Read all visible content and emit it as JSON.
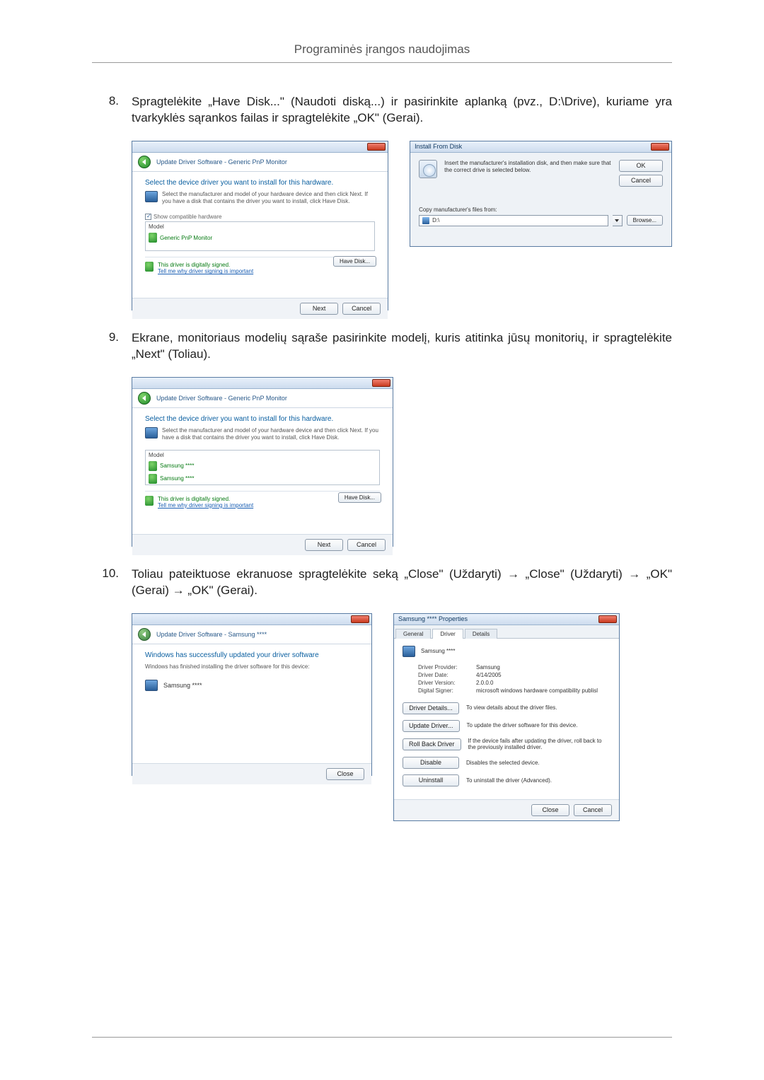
{
  "page": {
    "header": "Programinės įrangos naudojimas"
  },
  "steps": {
    "s8": {
      "num": "8.",
      "text": "Spragtelėkite „Have Disk...\" (Naudoti diską...) ir pasirinkite aplanką (pvz., D:\\Drive), kuriame yra tvarkyklės sąrankos failas ir spragtelėkite „OK\" (Gerai)."
    },
    "s9": {
      "num": "9.",
      "text": "Ekrane, monitoriaus modelių sąraše pasirinkite modelį, kuris atitinka jūsų monitorių, ir spragtelėkite „Next\" (Toliau)."
    },
    "s10": {
      "num": "10.",
      "text": "Toliau pateiktuose ekranuose spragtelėkite seką „Close\" (Uždaryti) → „Close\" (Uždaryti) → „OK\" (Gerai) → „OK\" (Gerai)."
    }
  },
  "wiz1": {
    "breadcrumb": "Update Driver Software - Generic PnP Monitor",
    "heading": "Select the device driver you want to install for this hardware.",
    "sub": "Select the manufacturer and model of your hardware device and then click Next. If you have a disk that contains the driver you want to install, click Have Disk.",
    "chk": "Show compatible hardware",
    "col": "Model",
    "item1": "Generic PnP Monitor",
    "signed": "This driver is digitally signed.",
    "signed_link": "Tell me why driver signing is important",
    "havedisk": "Have Disk...",
    "next": "Next",
    "cancel": "Cancel"
  },
  "ifd": {
    "title": "Install From Disk",
    "text": "Insert the manufacturer's installation disk, and then make sure that the correct drive is selected below.",
    "ok": "OK",
    "cancel": "Cancel",
    "copy": "Copy manufacturer's files from:",
    "path": "D:\\",
    "browse": "Browse..."
  },
  "wiz2": {
    "breadcrumb": "Update Driver Software - Generic PnP Monitor",
    "heading": "Select the device driver you want to install for this hardware.",
    "sub": "Select the manufacturer and model of your hardware device and then click Next. If you have a disk that contains the driver you want to install, click Have Disk.",
    "col": "Model",
    "item1": "Samsung ****",
    "item2": "Samsung ****",
    "signed": "This driver is digitally signed.",
    "signed_link": "Tell me why driver signing is important",
    "havedisk": "Have Disk...",
    "next": "Next",
    "cancel": "Cancel"
  },
  "wiz3": {
    "breadcrumb": "Update Driver Software - Samsung ****",
    "heading": "Windows has successfully updated your driver software",
    "sub": "Windows has finished installing the driver software for this device:",
    "model": "Samsung ****",
    "close": "Close"
  },
  "props": {
    "title": "Samsung **** Properties",
    "tab_general": "General",
    "tab_driver": "Driver",
    "tab_details": "Details",
    "device": "Samsung ****",
    "provider_k": "Driver Provider:",
    "provider_v": "Samsung",
    "date_k": "Driver Date:",
    "date_v": "4/14/2005",
    "version_k": "Driver Version:",
    "version_v": "2.0.0.0",
    "signer_k": "Digital Signer:",
    "signer_v": "microsoft windows hardware compatibility publisl",
    "btn_details": "Driver Details...",
    "btn_details_d": "To view details about the driver files.",
    "btn_update": "Update Driver...",
    "btn_update_d": "To update the driver software for this device.",
    "btn_rollback": "Roll Back Driver",
    "btn_rollback_d": "If the device fails after updating the driver, roll back to the previously installed driver.",
    "btn_disable": "Disable",
    "btn_disable_d": "Disables the selected device.",
    "btn_uninstall": "Uninstall",
    "btn_uninstall_d": "To uninstall the driver (Advanced).",
    "close": "Close",
    "cancel": "Cancel"
  }
}
